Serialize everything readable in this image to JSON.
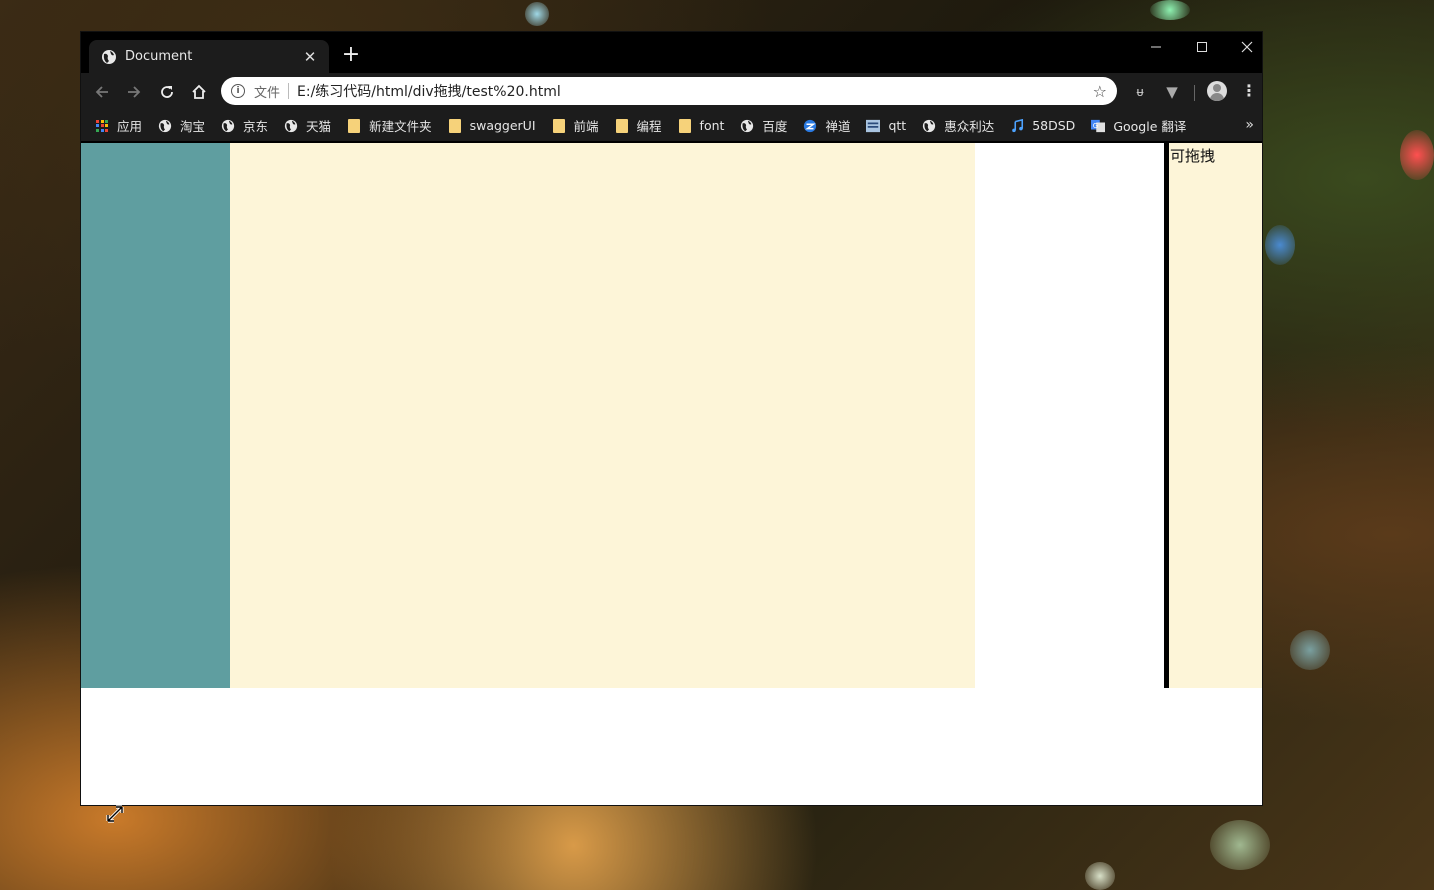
{
  "tab": {
    "title": "Document",
    "close": "✕"
  },
  "new_tab": "+",
  "window_controls": {
    "minimize": "—",
    "maximize": "☐",
    "close": "✕"
  },
  "address_bar": {
    "scheme_label": "文件",
    "url": "E:/练习代码/html/div拖拽/test%20.html",
    "star": "☆"
  },
  "extensions": [
    {
      "label": "ᵾ"
    },
    {
      "label": "▼"
    }
  ],
  "menu": "⋮",
  "bookmarks": [
    {
      "label": "应用",
      "icon": "apps-icon"
    },
    {
      "label": "淘宝",
      "icon": "globe-icon"
    },
    {
      "label": "京东",
      "icon": "globe-icon"
    },
    {
      "label": "天猫",
      "icon": "globe-icon"
    },
    {
      "label": "新建文件夹",
      "icon": "folder-icon"
    },
    {
      "label": "swaggerUI",
      "icon": "folder-icon"
    },
    {
      "label": "前端",
      "icon": "folder-icon"
    },
    {
      "label": "编程",
      "icon": "folder-icon"
    },
    {
      "label": "font",
      "icon": "folder-icon"
    },
    {
      "label": "百度",
      "icon": "globe-icon"
    },
    {
      "label": "禅道",
      "icon": "zentao-icon"
    },
    {
      "label": "qtt",
      "icon": "qtt-icon"
    },
    {
      "label": "惠众利达",
      "icon": "globe-icon"
    },
    {
      "label": "58DSD",
      "icon": "music-icon"
    },
    {
      "label": "Google 翻译",
      "icon": "translate-icon"
    }
  ],
  "bookmarks_overflow": "»",
  "page": {
    "draggable_label": "可拖拽"
  },
  "colors": {
    "left_panel": "#5f9ea0",
    "content_panel": "#fdf5d8",
    "drag_handle": "#000000"
  }
}
